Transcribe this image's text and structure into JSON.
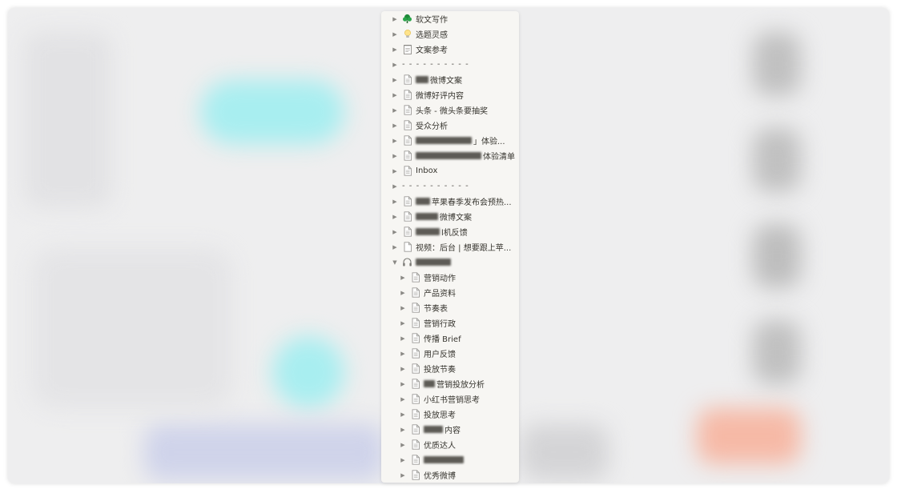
{
  "colors": {
    "panel_bg": "#f7f6f3",
    "text": "#37352f",
    "backdrop": "#eeeeef"
  },
  "items": [
    {
      "label": "软文写作",
      "icon": "green-tree-icon",
      "arrow": "▶",
      "blur": 0
    },
    {
      "label": "选题灵感",
      "icon": "lightbulb-icon",
      "arrow": "▶",
      "blur": 0
    },
    {
      "label": "文案参考",
      "icon": "notepad-icon",
      "arrow": "▶",
      "blur": 0
    },
    {
      "label": "- - - - - - - - - -",
      "icon": "separator-icon",
      "arrow": "▶",
      "blur": 0
    },
    {
      "label": "微博文案",
      "icon": "page-icon",
      "arrow": "▶",
      "blur": 16
    },
    {
      "label": "微博好评内容",
      "icon": "page-icon",
      "arrow": "▶",
      "blur": 0
    },
    {
      "label": "头条 - 微头条要抽奖",
      "icon": "page-icon",
      "arrow": "▶",
      "blur": 0
    },
    {
      "label": "受众分析",
      "icon": "page-icon",
      "arrow": "▶",
      "blur": 0
    },
    {
      "label": "」体验...",
      "icon": "page-icon",
      "arrow": "▶",
      "blur": 70
    },
    {
      "label": "体验清单",
      "icon": "page-icon",
      "arrow": "▶",
      "blur": 82
    },
    {
      "label": "Inbox",
      "icon": "page-icon",
      "arrow": "▶",
      "blur": 0
    },
    {
      "label": "- - - - - - - - - -",
      "icon": "separator-icon",
      "arrow": "▶",
      "blur": 0
    },
    {
      "label": "苹果春季发布会预热...",
      "icon": "page-icon",
      "arrow": "▶",
      "blur": 18
    },
    {
      "label": "微博文案",
      "icon": "page-icon",
      "arrow": "▶",
      "blur": 28
    },
    {
      "label": "l机反馈",
      "icon": "page-icon",
      "arrow": "▶",
      "blur": 30
    },
    {
      "label": "视频：后台 | 想要跟上苹...",
      "icon": "blank-page-icon",
      "arrow": "▶",
      "blur": 0
    },
    {
      "label": "",
      "icon": "headphones-icon",
      "arrow": "▼",
      "blur": 44
    },
    {
      "label": "营销动作",
      "icon": "page-icon",
      "arrow": "▶",
      "blur": 0,
      "child": true
    },
    {
      "label": "产品资料",
      "icon": "page-icon",
      "arrow": "▶",
      "blur": 0,
      "child": true
    },
    {
      "label": "节奏表",
      "icon": "page-icon",
      "arrow": "▶",
      "blur": 0,
      "child": true
    },
    {
      "label": "营销行政",
      "icon": "page-icon",
      "arrow": "▶",
      "blur": 0,
      "child": true
    },
    {
      "label": "传播 Brief",
      "icon": "page-icon",
      "arrow": "▶",
      "blur": 0,
      "child": true
    },
    {
      "label": "用户反馈",
      "icon": "page-icon",
      "arrow": "▶",
      "blur": 0,
      "child": true
    },
    {
      "label": "投放节奏",
      "icon": "page-icon",
      "arrow": "▶",
      "blur": 0,
      "child": true
    },
    {
      "label": "营销投放分析",
      "icon": "page-icon",
      "arrow": "▶",
      "blur": 14,
      "child": true
    },
    {
      "label": "小红书营销思考",
      "icon": "page-icon",
      "arrow": "▶",
      "blur": 0,
      "child": true
    },
    {
      "label": "投放思考",
      "icon": "page-icon",
      "arrow": "▶",
      "blur": 0,
      "child": true
    },
    {
      "label": "内容",
      "icon": "page-icon",
      "arrow": "▶",
      "blur": 24,
      "child": true
    },
    {
      "label": "优质达人",
      "icon": "page-icon",
      "arrow": "▶",
      "blur": 0,
      "child": true
    },
    {
      "label": "",
      "icon": "page-icon",
      "arrow": "▶",
      "blur": 50,
      "child": true
    },
    {
      "label": "优秀微博",
      "icon": "page-icon",
      "arrow": "▶",
      "blur": 0,
      "child": true
    }
  ]
}
